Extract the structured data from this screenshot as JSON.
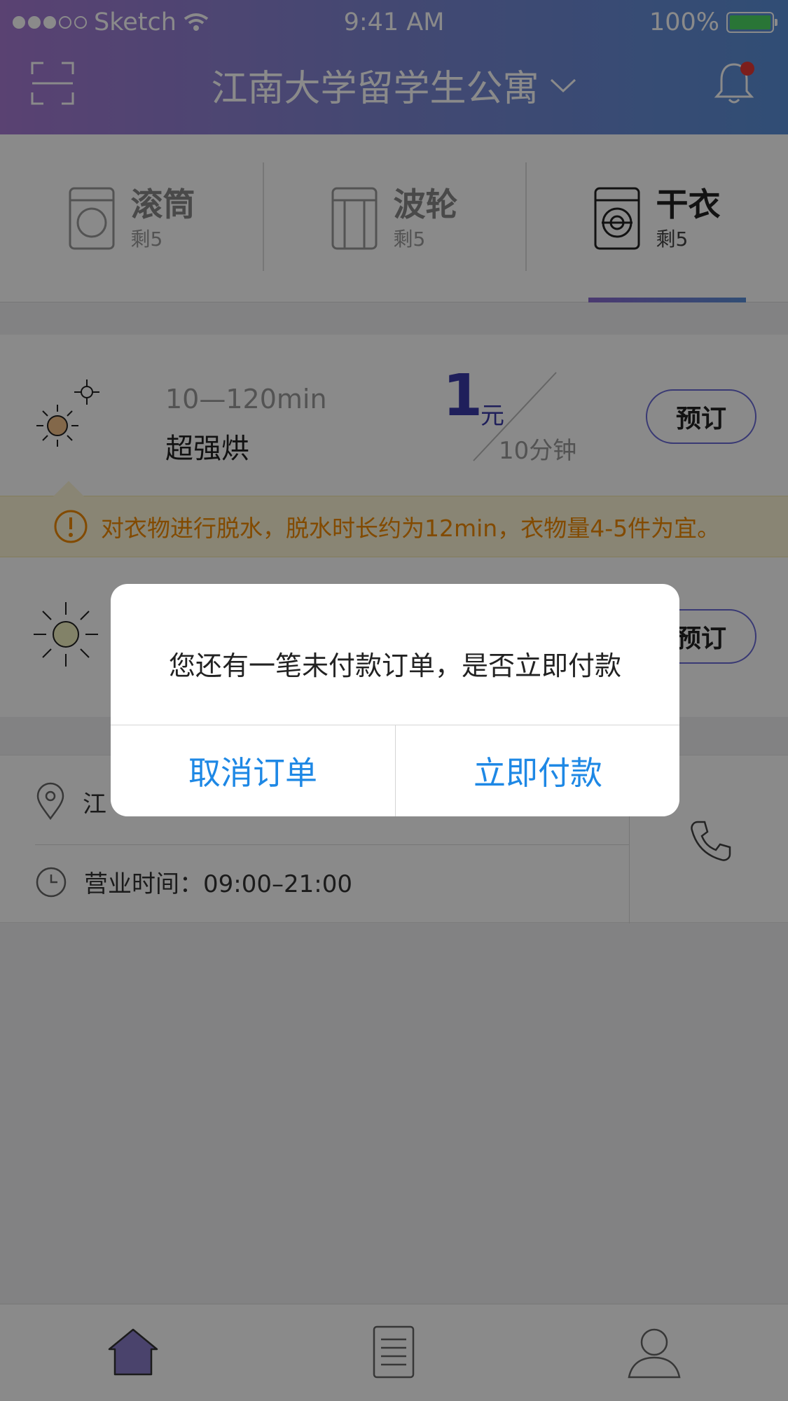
{
  "status_bar": {
    "carrier": "Sketch",
    "time": "9:41 AM",
    "battery": "100%",
    "signal_dots": 5,
    "signal_filled": 3,
    "battery_color": "#4cd964"
  },
  "header": {
    "title": "江南大学留学生公寓",
    "scan_icon": "scan-icon",
    "bell_icon": "bell-icon",
    "has_notification": true,
    "gradient": [
      "#a67ad2",
      "#5a8fd8"
    ]
  },
  "tabs": [
    {
      "name": "滚筒",
      "count": "剩5",
      "icon": "drum-washer-icon",
      "active": false
    },
    {
      "name": "波轮",
      "count": "剩5",
      "icon": "impeller-washer-icon",
      "active": false
    },
    {
      "name": "干衣",
      "count": "剩5",
      "icon": "dryer-icon",
      "active": true
    }
  ],
  "programs": [
    {
      "time_range": "10—120min",
      "name": "超强烘",
      "price": "1",
      "unit": "元",
      "per": "10分钟",
      "button": "预订",
      "icon": "sun-setting-icon"
    },
    {
      "button": "预订",
      "icon": "sun-icon"
    }
  ],
  "warning": {
    "text": "对衣物进行脱水，脱水时长约为12min，衣物量4-5件为宜。",
    "color": "#f08a00"
  },
  "info": {
    "address_partial": "江",
    "hours_label": "营业时间：",
    "hours_value": "09:00–21:00"
  },
  "bottom_nav": [
    {
      "name": "home",
      "icon": "home-icon",
      "active": true
    },
    {
      "name": "orders",
      "icon": "document-icon",
      "active": false
    },
    {
      "name": "profile",
      "icon": "user-icon",
      "active": false
    }
  ],
  "dialog": {
    "message": "您还有一笔未付款订单，是否立即付款",
    "cancel_label": "取消订单",
    "confirm_label": "立即付款",
    "button_color": "#1e88e5"
  }
}
